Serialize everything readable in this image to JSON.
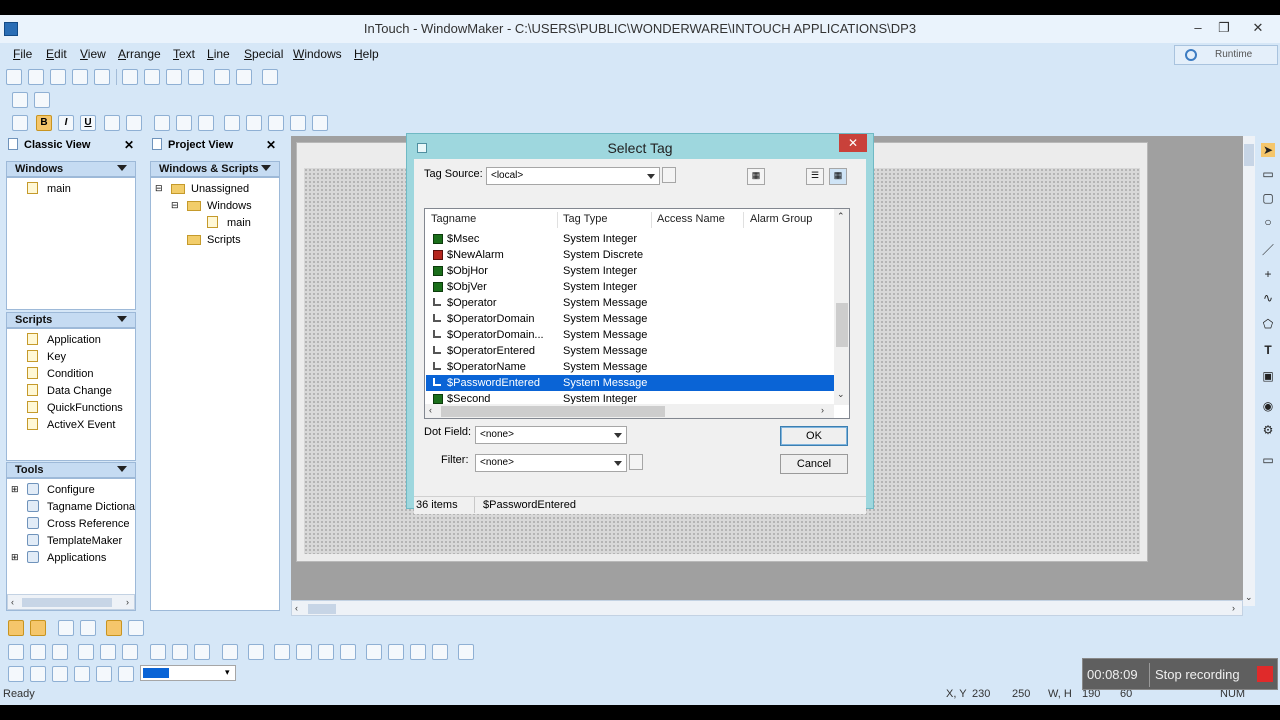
{
  "window": {
    "title": "InTouch - WindowMaker - C:\\USERS\\PUBLIC\\WONDERWARE\\INTOUCH APPLICATIONS\\DP3",
    "controls": [
      "–",
      "❐",
      "✕"
    ]
  },
  "menu": [
    "File",
    "Edit",
    "View",
    "Arrange",
    "Text",
    "Line",
    "Special",
    "Windows",
    "Help"
  ],
  "runtime_label": "Runtime",
  "classic_view": {
    "title": "Classic View",
    "windows_header": "Windows",
    "windows_items": [
      "main"
    ],
    "scripts_header": "Scripts",
    "scripts_items": [
      "Application",
      "Key",
      "Condition",
      "Data Change",
      "QuickFunctions",
      "ActiveX Event"
    ],
    "tools_header": "Tools",
    "tools_items": [
      "Configure",
      "Tagname Dictionary",
      "Cross Reference",
      "TemplateMaker",
      "Applications"
    ]
  },
  "project_view": {
    "title": "Project View",
    "header": "Windows & Scripts",
    "tree": [
      "Unassigned",
      "Windows",
      "main",
      "Scripts"
    ]
  },
  "dialog": {
    "title": "Select Tag",
    "tag_source_label": "Tag Source:",
    "tag_source_value": "<local>",
    "columns": [
      "Tagname",
      "Tag Type",
      "Access Name",
      "Alarm Group"
    ],
    "rows": [
      {
        "name": "$Msec",
        "type": "System Integer",
        "icon": "int"
      },
      {
        "name": "$NewAlarm",
        "type": "System Discrete",
        "icon": "disc"
      },
      {
        "name": "$ObjHor",
        "type": "System Integer",
        "icon": "int"
      },
      {
        "name": "$ObjVer",
        "type": "System Integer",
        "icon": "int"
      },
      {
        "name": "$Operator",
        "type": "System Message",
        "icon": "msg"
      },
      {
        "name": "$OperatorDomain",
        "type": "System Message",
        "icon": "msg"
      },
      {
        "name": "$OperatorDomain...",
        "type": "System Message",
        "icon": "msg"
      },
      {
        "name": "$OperatorEntered",
        "type": "System Message",
        "icon": "msg"
      },
      {
        "name": "$OperatorName",
        "type": "System Message",
        "icon": "msg"
      },
      {
        "name": "$PasswordEntered",
        "type": "System Message",
        "icon": "msg",
        "selected": true
      },
      {
        "name": "$Second",
        "type": "System Integer",
        "icon": "int"
      }
    ],
    "dot_field_label": "Dot Field:",
    "dot_field_value": "<none>",
    "filter_label": "Filter:",
    "filter_value": "<none>",
    "ok_label": "OK",
    "cancel_label": "Cancel",
    "status_count": "36 items",
    "status_selected": "$PasswordEntered",
    "close": "✕"
  },
  "statusbar": {
    "ready": "Ready",
    "xy_label": "X, Y",
    "x": "230",
    "y": "250",
    "wh_label": "W, H",
    "w": "190",
    "h": "60",
    "num": "NUM"
  },
  "recording": {
    "time": "00:08:09",
    "stop_label": "Stop recording"
  },
  "toolbar": {
    "bold": "B",
    "italic": "I",
    "underline": "U"
  }
}
